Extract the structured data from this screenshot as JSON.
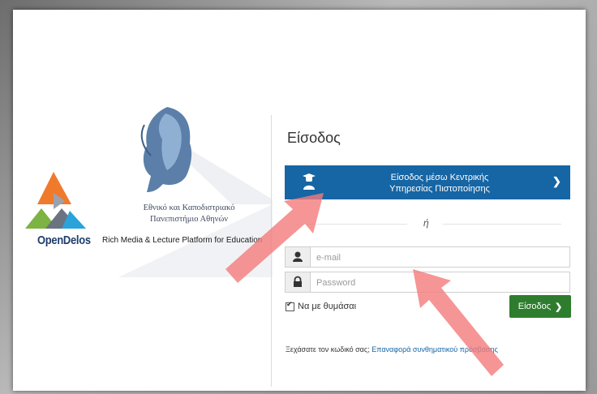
{
  "logo": {
    "university_line1": "Εθνικό και Καποδιστριακό",
    "university_line2": "Πανεπιστήμιο Αθηνών",
    "brand": "OpenDelos",
    "tagline": "Rich Media & Lecture Platform for Education"
  },
  "login": {
    "title": "Είσοδος",
    "sso_line1": "Είσοδος μέσω Κεντρικής",
    "sso_line2": "Υπηρεσίας Πιστοποίησης",
    "sso_icon": "graduate-user-icon",
    "or": "ή",
    "email_placeholder": "e-mail",
    "email_icon": "user-icon",
    "password_placeholder": "Password",
    "password_icon": "lock-icon",
    "remember_label": "Να με θυμάσαι",
    "remember_checked": true,
    "submit_label": "Είσοδος",
    "forgot_text": "Ξεχάσατε τον κωδικό σας;",
    "forgot_link": "Επαναφορά συνθηματικού πρόσβασης"
  },
  "colors": {
    "sso_blue": "#1665a4",
    "submit_green": "#2e7d2e",
    "annotation_arrow": "#f47a7a"
  }
}
